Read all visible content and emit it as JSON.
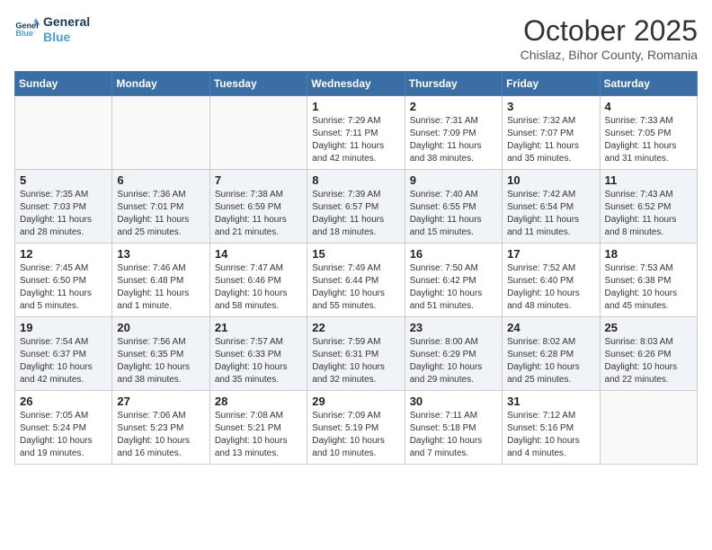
{
  "header": {
    "logo_line1": "General",
    "logo_line2": "Blue",
    "month_title": "October 2025",
    "subtitle": "Chislaz, Bihor County, Romania"
  },
  "days_of_week": [
    "Sunday",
    "Monday",
    "Tuesday",
    "Wednesday",
    "Thursday",
    "Friday",
    "Saturday"
  ],
  "weeks": [
    [
      {
        "num": "",
        "info": ""
      },
      {
        "num": "",
        "info": ""
      },
      {
        "num": "",
        "info": ""
      },
      {
        "num": "1",
        "info": "Sunrise: 7:29 AM\nSunset: 7:11 PM\nDaylight: 11 hours and 42 minutes."
      },
      {
        "num": "2",
        "info": "Sunrise: 7:31 AM\nSunset: 7:09 PM\nDaylight: 11 hours and 38 minutes."
      },
      {
        "num": "3",
        "info": "Sunrise: 7:32 AM\nSunset: 7:07 PM\nDaylight: 11 hours and 35 minutes."
      },
      {
        "num": "4",
        "info": "Sunrise: 7:33 AM\nSunset: 7:05 PM\nDaylight: 11 hours and 31 minutes."
      }
    ],
    [
      {
        "num": "5",
        "info": "Sunrise: 7:35 AM\nSunset: 7:03 PM\nDaylight: 11 hours and 28 minutes."
      },
      {
        "num": "6",
        "info": "Sunrise: 7:36 AM\nSunset: 7:01 PM\nDaylight: 11 hours and 25 minutes."
      },
      {
        "num": "7",
        "info": "Sunrise: 7:38 AM\nSunset: 6:59 PM\nDaylight: 11 hours and 21 minutes."
      },
      {
        "num": "8",
        "info": "Sunrise: 7:39 AM\nSunset: 6:57 PM\nDaylight: 11 hours and 18 minutes."
      },
      {
        "num": "9",
        "info": "Sunrise: 7:40 AM\nSunset: 6:55 PM\nDaylight: 11 hours and 15 minutes."
      },
      {
        "num": "10",
        "info": "Sunrise: 7:42 AM\nSunset: 6:54 PM\nDaylight: 11 hours and 11 minutes."
      },
      {
        "num": "11",
        "info": "Sunrise: 7:43 AM\nSunset: 6:52 PM\nDaylight: 11 hours and 8 minutes."
      }
    ],
    [
      {
        "num": "12",
        "info": "Sunrise: 7:45 AM\nSunset: 6:50 PM\nDaylight: 11 hours and 5 minutes."
      },
      {
        "num": "13",
        "info": "Sunrise: 7:46 AM\nSunset: 6:48 PM\nDaylight: 11 hours and 1 minute."
      },
      {
        "num": "14",
        "info": "Sunrise: 7:47 AM\nSunset: 6:46 PM\nDaylight: 10 hours and 58 minutes."
      },
      {
        "num": "15",
        "info": "Sunrise: 7:49 AM\nSunset: 6:44 PM\nDaylight: 10 hours and 55 minutes."
      },
      {
        "num": "16",
        "info": "Sunrise: 7:50 AM\nSunset: 6:42 PM\nDaylight: 10 hours and 51 minutes."
      },
      {
        "num": "17",
        "info": "Sunrise: 7:52 AM\nSunset: 6:40 PM\nDaylight: 10 hours and 48 minutes."
      },
      {
        "num": "18",
        "info": "Sunrise: 7:53 AM\nSunset: 6:38 PM\nDaylight: 10 hours and 45 minutes."
      }
    ],
    [
      {
        "num": "19",
        "info": "Sunrise: 7:54 AM\nSunset: 6:37 PM\nDaylight: 10 hours and 42 minutes."
      },
      {
        "num": "20",
        "info": "Sunrise: 7:56 AM\nSunset: 6:35 PM\nDaylight: 10 hours and 38 minutes."
      },
      {
        "num": "21",
        "info": "Sunrise: 7:57 AM\nSunset: 6:33 PM\nDaylight: 10 hours and 35 minutes."
      },
      {
        "num": "22",
        "info": "Sunrise: 7:59 AM\nSunset: 6:31 PM\nDaylight: 10 hours and 32 minutes."
      },
      {
        "num": "23",
        "info": "Sunrise: 8:00 AM\nSunset: 6:29 PM\nDaylight: 10 hours and 29 minutes."
      },
      {
        "num": "24",
        "info": "Sunrise: 8:02 AM\nSunset: 6:28 PM\nDaylight: 10 hours and 25 minutes."
      },
      {
        "num": "25",
        "info": "Sunrise: 8:03 AM\nSunset: 6:26 PM\nDaylight: 10 hours and 22 minutes."
      }
    ],
    [
      {
        "num": "26",
        "info": "Sunrise: 7:05 AM\nSunset: 5:24 PM\nDaylight: 10 hours and 19 minutes."
      },
      {
        "num": "27",
        "info": "Sunrise: 7:06 AM\nSunset: 5:23 PM\nDaylight: 10 hours and 16 minutes."
      },
      {
        "num": "28",
        "info": "Sunrise: 7:08 AM\nSunset: 5:21 PM\nDaylight: 10 hours and 13 minutes."
      },
      {
        "num": "29",
        "info": "Sunrise: 7:09 AM\nSunset: 5:19 PM\nDaylight: 10 hours and 10 minutes."
      },
      {
        "num": "30",
        "info": "Sunrise: 7:11 AM\nSunset: 5:18 PM\nDaylight: 10 hours and 7 minutes."
      },
      {
        "num": "31",
        "info": "Sunrise: 7:12 AM\nSunset: 5:16 PM\nDaylight: 10 hours and 4 minutes."
      },
      {
        "num": "",
        "info": ""
      }
    ]
  ]
}
